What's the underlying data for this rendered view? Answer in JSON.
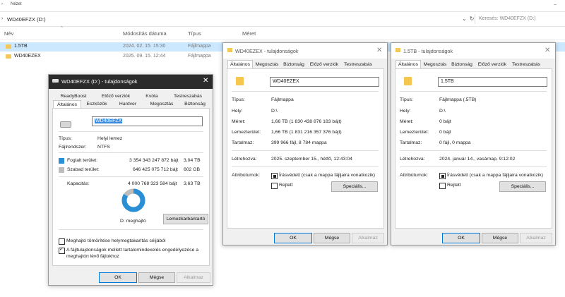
{
  "explorer": {
    "ribbon_view": "Nézet",
    "address": "WD40EFZX (D:)",
    "search_placeholder": "Keresés: WD40EFZX (D:)",
    "columns": {
      "name": "Név",
      "date": "Módosítás dátuma",
      "type": "Típus",
      "size": "Méret"
    },
    "rows": [
      {
        "name": "1.5TB",
        "date": "2024. 02. 15. 15:30",
        "type": "Fájlmappa"
      },
      {
        "name": "WD40EZEX",
        "date": "2025. 09. 15. 12:44",
        "type": "Fájlmappa"
      }
    ]
  },
  "drive_dialog": {
    "title": "WD40EFZX (D:) - tulajdonságok",
    "tabs_row1": [
      "ReadyBoost",
      "Előző verziók",
      "Kvóta",
      "Testreszabás"
    ],
    "tabs_row2": [
      "Általános",
      "Eszközök",
      "Hardver",
      "Megosztás",
      "Biztonság"
    ],
    "name_value": "WD40EFZX",
    "type_label": "Típus:",
    "type_value": "Helyi lemez",
    "fs_label": "Fájlrendszer:",
    "fs_value": "NTFS",
    "used_label": "Foglalt terület:",
    "used_bytes": "3 354 343 247 872 bájt",
    "used_size": "3,04 TB",
    "free_label": "Szabad terület:",
    "free_bytes": "646 425 075 712 bájt",
    "free_size": "602 GB",
    "cap_label": "Kapacitás:",
    "cap_bytes": "4 000 768 323 584 bájt",
    "cap_size": "3,63 TB",
    "used_fraction": 0.838,
    "drive_label": "D: meghajtó",
    "cleanup_button": "Lemezkarbantartó",
    "compress_label": "Meghajtó tömörítése helymegtakarítás céljából",
    "index_label": "A fájltulajdonságok mellett tartalomindexelés engedélyezése a meghajtón lévő fájlokhoz",
    "ok": "OK",
    "cancel": "Mégse",
    "apply": "Alkalmaz",
    "used_color": "#2b8fd6",
    "free_color": "#bdbdbd"
  },
  "folder_dialog_1": {
    "title": "WD40EZEX - tulajdonságok",
    "tabs": [
      "Általános",
      "Megosztás",
      "Biztonság",
      "Előző verziók",
      "Testreszabás"
    ],
    "name_value": "WD40EZEX",
    "type_label": "Típus:",
    "type_value": "Fájlmappa",
    "loc_label": "Hely:",
    "loc_value": "D:\\",
    "size_label": "Méret:",
    "size_value": "1,66 TB (1 830 438 876 183 bájt)",
    "disk_label": "Lemezterület:",
    "disk_value": "1,66 TB (1 831 216 357 376 bájt)",
    "contains_label": "Tartalmaz:",
    "contains_value": "399 966 fájl, 8 784 mappa",
    "created_label": "Létrehozva:",
    "created_value": "2025. szeptember 15., hétfő, 12:43:04",
    "attr_label": "Attribútumok:",
    "readonly_label": "Írásvédett (csak a mappa fájljaira vonatkozik)",
    "hidden_label": "Rejtett",
    "advanced_button": "Speciális...",
    "ok": "OK",
    "cancel": "Mégse",
    "apply": "Alkalmaz"
  },
  "folder_dialog_2": {
    "title": "1.5TB - tulajdonságok",
    "tabs": [
      "Általános",
      "Megosztás",
      "Biztonság",
      "Előző verziók",
      "Testreszabás"
    ],
    "name_value": "1.5TB",
    "type_label": "Típus:",
    "type_value": "Fájlmappa (.5TB)",
    "loc_label": "Hely:",
    "loc_value": "D:\\",
    "size_label": "Méret:",
    "size_value": "0 bájt",
    "disk_label": "Lemezterület:",
    "disk_value": "0 bájt",
    "contains_label": "Tartalmaz:",
    "contains_value": "0 fájl, 0 mappa",
    "created_label": "Létrehozva:",
    "created_value": "2024. január 14., vasárnap, 9:12:02",
    "attr_label": "Attribútumok:",
    "readonly_label": "Írásvédett (csak a mappa fájljaira vonatkozik)",
    "hidden_label": "Rejtett",
    "advanced_button": "Speciális...",
    "ok": "OK",
    "cancel": "Mégse",
    "apply": "Alkalmaz"
  }
}
